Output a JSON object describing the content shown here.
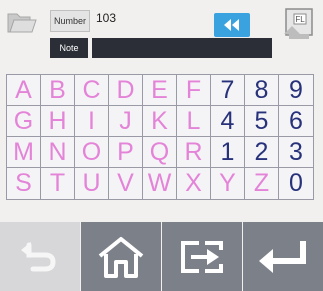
{
  "header": {
    "number_label": "Number",
    "number_value": "103",
    "note_label": "Note",
    "note_value": "",
    "fl_badge": "FL"
  },
  "keypad": {
    "rows": [
      [
        "A",
        "B",
        "C",
        "D",
        "E",
        "F",
        "7",
        "8",
        "9"
      ],
      [
        "G",
        "H",
        "I",
        "J",
        "K",
        "L",
        "4",
        "5",
        "6"
      ],
      [
        "M",
        "N",
        "O",
        "P",
        "Q",
        "R",
        "1",
        "2",
        "3"
      ],
      [
        "S",
        "T",
        "U",
        "V",
        "W",
        "X",
        "Y",
        "Z",
        "0"
      ]
    ]
  },
  "colors": {
    "letter": "#e484d8",
    "digit": "#27327a",
    "accent": "#3aa3df",
    "dark_field": "#2b2e37",
    "nav_active": "#7c8089",
    "nav_disabled": "#d7d7d9"
  },
  "icons": {
    "folder": "folder-icon",
    "backspace": "double-left-arrow-icon",
    "fl": "fl-settings-icon",
    "back": "undo-arrow-icon",
    "home": "home-icon",
    "exchange": "exchange-icon",
    "enter": "enter-icon"
  }
}
